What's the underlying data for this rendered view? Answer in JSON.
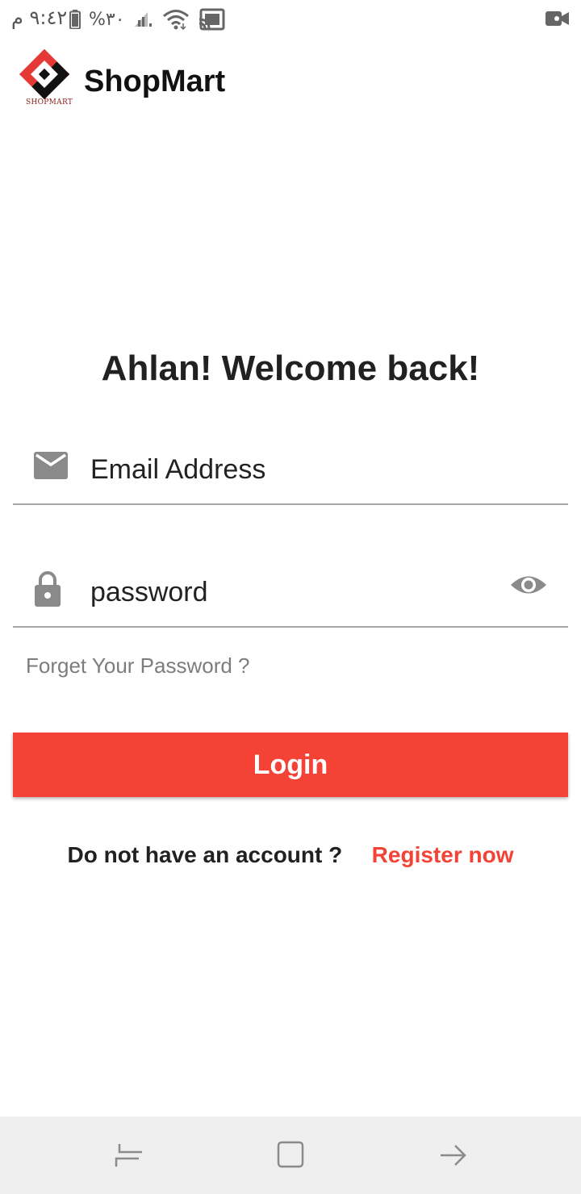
{
  "status_bar": {
    "time": "٩:٤٢ م",
    "battery": "%٣٠"
  },
  "header": {
    "app_title": "ShopMart",
    "logo_caption": "SHOPMART"
  },
  "login": {
    "welcome": "Ahlan! Welcome back!",
    "email_placeholder": "Email Address",
    "password_placeholder": "password",
    "forgot_label": "Forget Your Password ?",
    "login_label": "Login",
    "register_prompt": "Do not have an account ?",
    "register_link": "Register now"
  },
  "colors": {
    "accent": "#f44336",
    "icon_gray": "#8a8a8a",
    "text_dark": "#212121",
    "nav_bar": "#efefef"
  },
  "icons": {
    "email": "email-icon",
    "password": "lock-icon",
    "visibility": "eye-icon",
    "nav_recents": "recents-icon",
    "nav_home": "home-icon",
    "nav_back": "back-icon"
  }
}
